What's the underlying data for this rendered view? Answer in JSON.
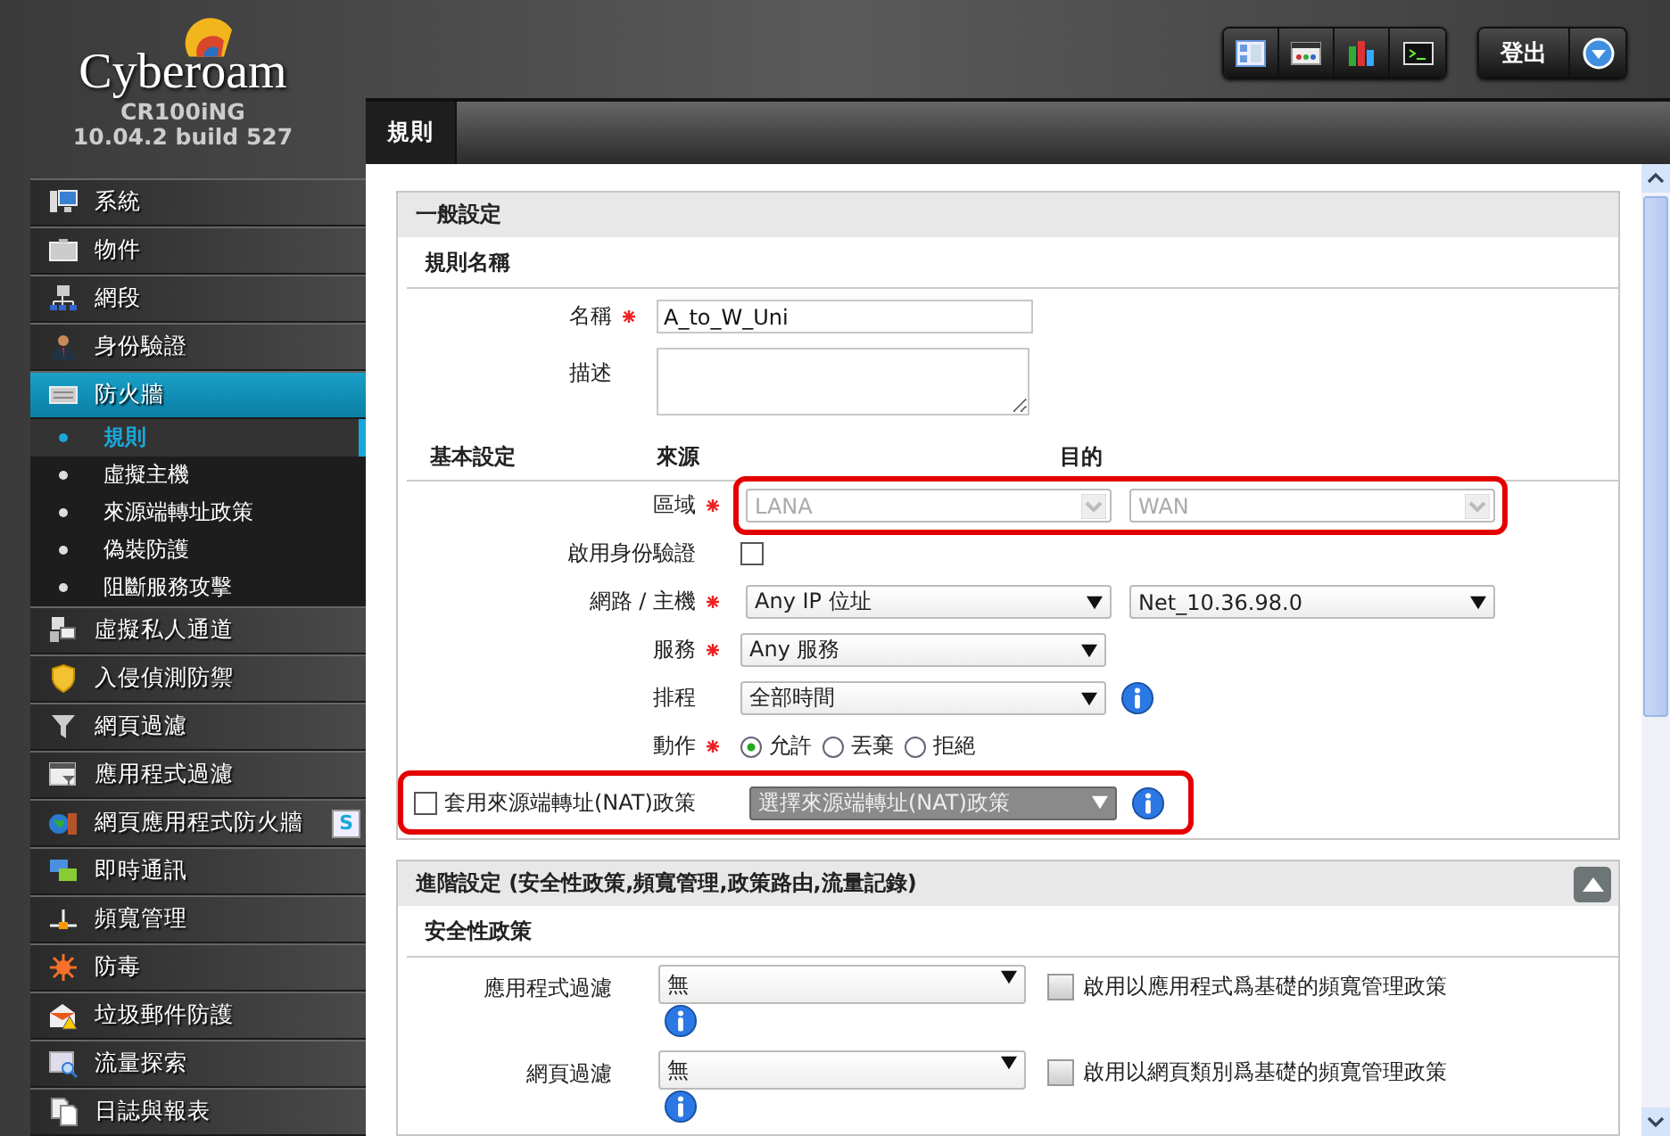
{
  "logo": {
    "brand": "Cyberoam",
    "model": "CR100iNG",
    "version": "10.04.2 build 527"
  },
  "toolbar": {
    "logout": "登出"
  },
  "sidebar": {
    "items": [
      {
        "label": "系統",
        "selected": false
      },
      {
        "label": "物件",
        "selected": false
      },
      {
        "label": "網段",
        "selected": false
      },
      {
        "label": "身份驗證",
        "selected": false
      },
      {
        "label": "防火牆",
        "selected": true,
        "expanded": true,
        "children": [
          {
            "label": "規則",
            "selected": true
          },
          {
            "label": "虛擬主機",
            "selected": false
          },
          {
            "label": "來源端轉址政策",
            "selected": false
          },
          {
            "label": "偽裝防護",
            "selected": false
          },
          {
            "label": "阻斷服務攻擊",
            "selected": false
          }
        ]
      },
      {
        "label": "虛擬私人通道",
        "selected": false
      },
      {
        "label": "入侵偵測防禦",
        "selected": false
      },
      {
        "label": "網頁過濾",
        "selected": false
      },
      {
        "label": "應用程式過濾",
        "selected": false
      },
      {
        "label": "網頁應用程式防火牆",
        "selected": false,
        "badge": "S"
      },
      {
        "label": "即時通訊",
        "selected": false
      },
      {
        "label": "頻寬管理",
        "selected": false
      },
      {
        "label": "防毒",
        "selected": false
      },
      {
        "label": "垃圾郵件防護",
        "selected": false
      },
      {
        "label": "流量探索",
        "selected": false
      },
      {
        "label": "日誌與報表",
        "selected": false
      }
    ]
  },
  "tabs": [
    {
      "label": "規則",
      "selected": true
    }
  ],
  "general": {
    "title": "一般設定",
    "subtitle": "規則名稱",
    "fields": [
      {
        "kind": "text",
        "label": "名稱",
        "required": true,
        "value": "A_to_W_Uni"
      },
      {
        "kind": "textarea",
        "label": "描述",
        "required": false
      }
    ]
  },
  "basic": {
    "columns": [
      "基本設定",
      "來源",
      "目的"
    ],
    "rows": [
      {
        "kind": "pair",
        "label": "區域",
        "required": true,
        "source": "LANA",
        "destination": "WAN",
        "disabled": true,
        "highlighted": true
      },
      {
        "kind": "checkbox",
        "label": "啟用身份驗證",
        "required": false,
        "checked": false
      },
      {
        "kind": "pair",
        "label": "網路 / 主機",
        "required": true,
        "source": "Any IP 位址",
        "destination": "Net_10.36.98.0",
        "disabled": false,
        "highlighted": false
      },
      {
        "kind": "select",
        "label": "服務",
        "required": true,
        "value": "Any 服務",
        "info": false
      },
      {
        "kind": "select",
        "label": "排程",
        "required": false,
        "value": "全部時間",
        "info": true
      },
      {
        "kind": "radio",
        "label": "動作",
        "required": true,
        "options": [
          {
            "label": "允許",
            "selected": true
          },
          {
            "label": "丟棄",
            "selected": false
          },
          {
            "label": "拒絕",
            "selected": false
          }
        ]
      }
    ]
  },
  "nat": {
    "label": "套用來源端轉址(NAT)政策",
    "checked": false,
    "placeholder": "選擇來源端轉址(NAT)政策",
    "disabled": true,
    "highlighted": true
  },
  "advanced": {
    "title": "進階設定 (安全性政策,頻寬管理,政策路由,流量記錄)",
    "expanded": true,
    "subtitle": "安全性政策",
    "rows": [
      {
        "label": "應用程式過濾",
        "value": "無",
        "option": "啟用以應用程式爲基礎的頻寬管理政策",
        "checked": false
      },
      {
        "label": "網頁過濾",
        "value": "無",
        "option": "啟用以網頁類別爲基礎的頻寬管理政策",
        "checked": false
      }
    ]
  }
}
